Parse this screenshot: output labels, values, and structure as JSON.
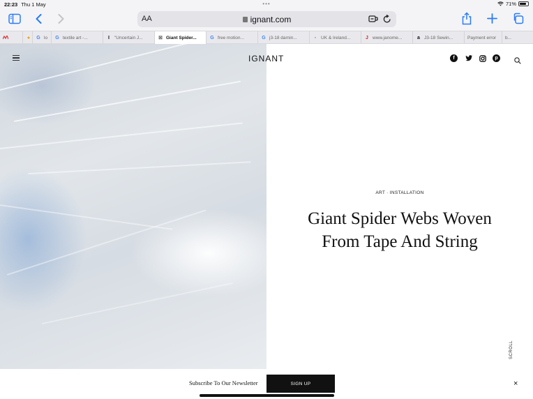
{
  "status_bar": {
    "time": "22:23",
    "date": "Thu 1 May",
    "battery": "71%",
    "battery_level": 0.71
  },
  "toolbar": {
    "text_size_label": "AA",
    "domain": "ignant.com",
    "icons": [
      "sidebar-icon",
      "back-icon",
      "forward-icon",
      "extension-icon",
      "reload-icon",
      "share-icon",
      "new-tab-icon",
      "tabs-overview-icon"
    ]
  },
  "tabs": [
    {
      "label": "",
      "favicon": "",
      "favicon_color": "#d33"
    },
    {
      "label": "",
      "favicon": "",
      "favicon_color": "#e8a400"
    },
    {
      "label": "lo",
      "favicon": "G",
      "favicon_color": "#4285f4"
    },
    {
      "label": "textile art -...",
      "favicon": "G",
      "favicon_color": "#4285f4"
    },
    {
      "label": "\"Uncertain J...",
      "favicon": "I",
      "favicon_color": "#111"
    },
    {
      "label": "Giant Spider...",
      "favicon": "⊠",
      "favicon_color": "#666",
      "active": true
    },
    {
      "label": "free motion...",
      "favicon": "G",
      "favicon_color": "#4285f4"
    },
    {
      "label": "j3-18 darnin...",
      "favicon": "G",
      "favicon_color": "#4285f4"
    },
    {
      "label": "UK & Ireland...",
      "favicon": "▪",
      "favicon_color": "#aaa"
    },
    {
      "label": "www.janome...",
      "favicon": "J",
      "favicon_color": "#d22"
    },
    {
      "label": "J3-18 Sewin...",
      "favicon": "a",
      "favicon_color": "#111"
    },
    {
      "label": "Payment error",
      "favicon": "",
      "favicon_color": "#aaa"
    },
    {
      "label": "b...",
      "favicon": "",
      "favicon_color": "#aaa"
    }
  ],
  "site": {
    "logo": "IGNANT",
    "social_icons": [
      "facebook-icon",
      "twitter-icon",
      "instagram-icon",
      "pinterest-icon"
    ],
    "category": "ART · INSTALLATION",
    "headline_line1": "Giant Spider Webs Woven",
    "headline_line2": "From Tape And String",
    "scroll_label": "SCROLL"
  },
  "newsletter": {
    "text": "Subscribe To Our Newsletter",
    "button": "SIGN UP",
    "close": "×"
  },
  "colors": {
    "accent": "#2a7bf6",
    "button_bg": "#111111"
  }
}
